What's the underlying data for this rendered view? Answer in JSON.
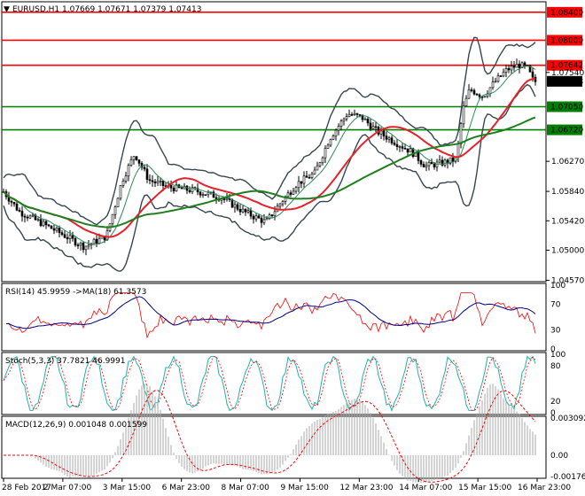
{
  "header": {
    "symbol": "EURUSD,H1",
    "ohlc": "1.07669 1.07671 1.07379 1.07413"
  },
  "colors": {
    "bg": "#ffffff",
    "red_line": "#ff0000",
    "green_line": "#007f00",
    "candle": "#000000",
    "ma_red": "#e8202a",
    "ma_green": "#1e7f1e",
    "ma_fast": "#2e8b57",
    "bands": "#37474f",
    "rsi": "#ff0000",
    "rsi_ma": "#000080",
    "stoch_main": "#20b2aa",
    "stoch_signal": "#ff0000",
    "macd_hist": "#a9a9a9",
    "macd_signal": "#ff0000"
  },
  "price_panel": {
    "axis_labels": [
      "1.08400",
      "1.08000",
      "1.07642",
      "1.07540",
      "1.07413",
      "1.07050",
      "1.06720",
      "1.06270",
      "1.05840",
      "1.05420",
      "1.05000",
      "1.04570"
    ],
    "hlines": [
      {
        "price": 1.084,
        "label": "1.08400",
        "kind": "resistance"
      },
      {
        "price": 1.08,
        "label": "1.08000",
        "kind": "resistance"
      },
      {
        "price": 1.07642,
        "label": "1.07642",
        "kind": "resistance"
      },
      {
        "price": 1.0705,
        "label": "1.07050",
        "kind": "support"
      },
      {
        "price": 1.0672,
        "label": "1.06720",
        "kind": "support"
      }
    ],
    "current_price": "1.07413",
    "range": [
      1.0455,
      1.0855
    ]
  },
  "rsi_panel": {
    "title": "RSI(14) 45.9959 ->MA(18) 61.3573",
    "levels": [
      "100",
      "70",
      "30",
      "0"
    ]
  },
  "stoch_panel": {
    "title": "Stoch(5,3,3) 37.7821 46.9991",
    "levels": [
      "100",
      "80",
      "20",
      "0"
    ]
  },
  "macd_panel": {
    "title": "MACD(12,26,9) 0.001048 0.001599",
    "levels": [
      "0.003092",
      "0.00",
      "-0.001767"
    ]
  },
  "time_axis": [
    "28 Feb 2017",
    "2 Mar 07:00",
    "3 Mar 15:00",
    "6 Mar 23:00",
    "8 Mar 07:00",
    "9 Mar 15:00",
    "12 Mar 23:00",
    "14 Mar 07:00",
    "15 Mar 15:00",
    "16 Mar 23:00"
  ],
  "chart_data": {
    "type": "line",
    "title": "EURUSD,H1",
    "ylim": [
      1.0455,
      1.0855
    ],
    "x": [
      "28 Feb 2017",
      "2 Mar 07:00",
      "3 Mar 15:00",
      "6 Mar 23:00",
      "8 Mar 07:00",
      "9 Mar 15:00",
      "12 Mar 23:00",
      "14 Mar 07:00",
      "15 Mar 15:00",
      "16 Mar 23:00"
    ],
    "series": [
      {
        "values": [
          1.0588,
          1.0515,
          1.0618,
          1.0578,
          1.0545,
          1.0605,
          1.0668,
          1.0622,
          1.0728,
          1.0741
        ]
      }
    ]
  }
}
